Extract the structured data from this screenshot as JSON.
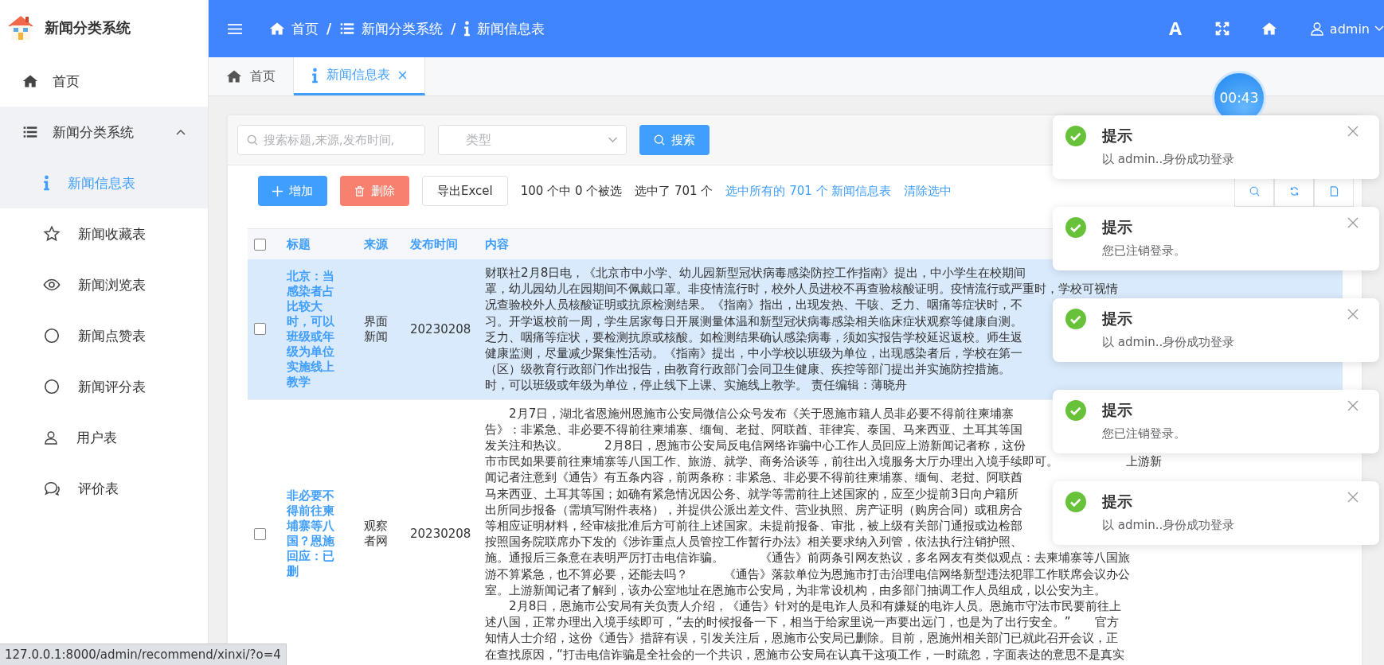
{
  "app": {
    "title": "新闻分类系统"
  },
  "sidebar": {
    "items": [
      {
        "label": "首页",
        "selected": false
      },
      {
        "label": "新闻分类系统",
        "expanded": true,
        "children": [
          {
            "label": "新闻信息表",
            "selected": true
          },
          {
            "label": "新闻收藏表",
            "selected": false
          },
          {
            "label": "新闻浏览表",
            "selected": false
          },
          {
            "label": "新闻点赞表",
            "selected": false
          },
          {
            "label": "新闻评分表",
            "selected": false
          },
          {
            "label": "用户表",
            "selected": false
          },
          {
            "label": "评价表",
            "selected": false
          }
        ]
      }
    ]
  },
  "header": {
    "breadcrumb": [
      {
        "label": "首页"
      },
      {
        "label": "新闻分类系统"
      },
      {
        "label": "新闻信息表"
      }
    ],
    "separator": "/",
    "user": "admin"
  },
  "tabs": [
    {
      "label": "首页",
      "selected": false,
      "closable": false
    },
    {
      "label": "新闻信息表",
      "selected": true,
      "closable": true
    }
  ],
  "search": {
    "placeholder": "搜索标题,来源,发布时间,",
    "type_placeholder": "类型",
    "button": "搜索"
  },
  "actions": {
    "add": "增加",
    "delete": "删除",
    "export": "导出Excel",
    "selection_count": "100 个中 0 个被选",
    "selected_total": "选中了 701 个",
    "select_all_link": "选中所有的 701 个 新闻信息表",
    "clear_link": "清除选中"
  },
  "table": {
    "select_all_checked": false,
    "columns": [
      "标题",
      "来源",
      "发布时间",
      "内容"
    ],
    "rows": [
      {
        "selected": true,
        "checked": false,
        "title": "北京：当感染者占比较大时，可以班级或年级为单位实施线上教学",
        "source": "界面新闻",
        "date": "20230208",
        "lines": [
          {
            "text": "财联社2月8日电，《北京市中小学、幼儿园新型冠状病毒感染防控工作指南》提出，中小学生在校期间"
          },
          {
            "text": "罩，幼儿园幼儿在园期间不佩戴口罩。非疫情流行时，校外人员进校不再查验核酸证明。疫情流行或严重时，学校可视情"
          },
          {
            "text": "况查验校外人员核酸证明或抗原检测结果。《指南》指出，出现发热、干咳、乏力、咽痛等症状时，不"
          },
          {
            "text": "习。开学返校前一周，学生居家每日开展测量体温和新型冠状病毒感染相关临床症状观察等健康自测。"
          },
          {
            "text": "乏力、咽痛等症状，要检测抗原或核酸。如检测结果确认感染病毒，须如实报告学校延迟返校。师生返"
          },
          {
            "text": "健康监测，尽量减少聚集性活动。《指南》提出，中小学校以班级为单位，出现感染者后，学校在第一"
          },
          {
            "text": "（区）级教育行政部门作出报告，由教育行政部门会同卫生健康、疾控等部门提出并实施防控措施。"
          },
          {
            "text": "时，可以班级或年级为单位，停止线下上课、实施线上教学。 责任编辑：薄晓舟"
          }
        ]
      },
      {
        "selected": false,
        "checked": false,
        "title": "非必要不得前往柬埔寨等八国？恩施回应：已删",
        "source": "观察者网",
        "date": "20230208",
        "lines": [
          {
            "text": "　　2月7日，湖北省恩施州恩施市公安局微信公众号发布《关于恩施市籍人员非必要不得前往柬埔寨"
          },
          {
            "text": "告》：非紧急、非必要不得前往柬埔寨、缅甸、老挝、阿联酋、菲律宾、泰国、马来西亚、土耳其等国"
          },
          {
            "text": "发关注和热议。　　　2月8日，恩施市公安局反电信网络诈骗中心工作人员回应上游新闻记者称，这份"
          },
          {
            "text": "市市民如果要前往柬埔寨等八国工作、旅游、就学、商务洽谈等，前往出入境服务大厅办理出入境手续即可。",
            "tail": "上游新"
          },
          {
            "text": "闻记者注意到《通告》有五条内容，前两条称：非紧急、非必要不得前往柬埔寨、缅甸、老挝、阿联酋"
          },
          {
            "text": "马来西亚、土耳其等国；如确有紧急情况因公务、就学等需前往上述国家的，应至少提前3日向户籍所"
          },
          {
            "text": "出所同步报备（需填写附件表格），并提供公派出差文件、营业执照、房产证明（购房合同）或租房合"
          },
          {
            "text": "等相应证明材料，经审核批准后方可前往上述国家。未提前报备、审批，被上级有关部门通报或边检部"
          },
          {
            "text": "按照国务院联席办下发的《涉诈重点人员管控工作暂行办法》相关要求纳入列管，依法执行注销护照、"
          },
          {
            "text": "施。通报后三条意在表明严厉打击电信诈骗。　　　《通告》前两条引网友热议，多名网友有类似观点：去柬埔寨等八国旅"
          },
          {
            "text": "游不算紧急，也不算必要，还能去吗？　　　《通告》落款单位为恩施市打击治理电信网络新型违法犯罪工作联席会议办公"
          },
          {
            "text": "室。上游新闻记者了解到，该办公室地址在恩施市公安局，为非常设机构，由多部门抽调工作人员组成，以公安为主。"
          },
          {
            "text": "　　2月8日，恩施市公安局有关负责人介绍，《通告》针对的是电诈人员和有嫌疑的电诈人员。恩施市守法市民要前往上"
          },
          {
            "text": "述八国，正常办理出入境手续即可，“去的时候报备一下，相当于给家里说一声要出远门，也是为了出行安全。”　　官方"
          },
          {
            "text": "知情人士介绍，这份《通告》措辞有误，引发关注后，恩施市公安局已删除。目前，恩施州相关部门已就此召开会议，正"
          },
          {
            "text": "在查找原因，“打击电信诈骗是全社会的一个共识，恩施市公安局在认真干这项工作，一时疏忽，字面表达的意思不是真实"
          }
        ]
      }
    ]
  },
  "timer": "00:43",
  "notifications": [
    {
      "title": "提示",
      "message": "以 admin..身份成功登录"
    },
    {
      "title": "提示",
      "message": "您已注销登录。"
    },
    {
      "title": "提示",
      "message": "以 admin..身份成功登录"
    },
    {
      "title": "提示",
      "message": "您已注销登录。"
    },
    {
      "title": "提示",
      "message": "以 admin..身份成功登录"
    }
  ],
  "status_bar": {
    "url": "127.0.0.1:8000/admin/recommend/xinxi/?o=4"
  }
}
